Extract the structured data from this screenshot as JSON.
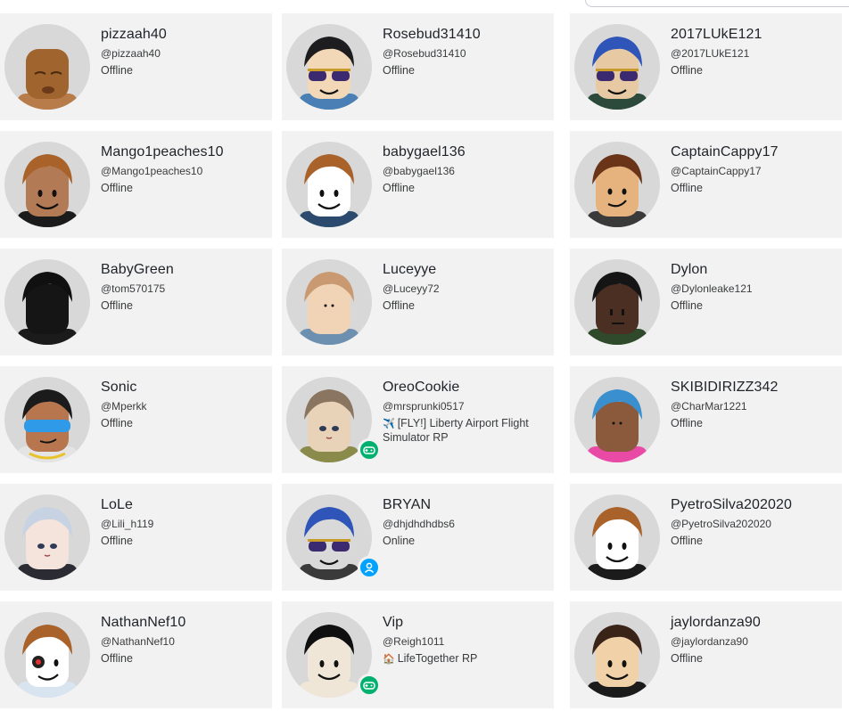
{
  "friends": [
    {
      "name": "pizzaah40",
      "handle": "@pizzaah40",
      "status": "Offline",
      "status_icon": "",
      "presence": "none",
      "avatar": {
        "skin": "#a0652e",
        "hair": "",
        "shirt": "#b87b4a",
        "face": "chubby"
      }
    },
    {
      "name": "Rosebud31410",
      "handle": "@Rosebud31410",
      "status": "Offline",
      "status_icon": "",
      "presence": "none",
      "avatar": {
        "skin": "#f3d8b8",
        "hair": "#1d1d1f",
        "shirt": "#4a7fb5",
        "face": "shades"
      }
    },
    {
      "name": "2017LUkE121",
      "handle": "@2017LUkE121",
      "status": "Offline",
      "status_icon": "",
      "presence": "none",
      "avatar": {
        "skin": "#e7c9a3",
        "hair": "#2f55b8",
        "shirt": "#2c4a3b",
        "face": "shades"
      }
    },
    {
      "name": "Mango1peaches10",
      "handle": "@Mango1peaches10",
      "status": "Offline",
      "status_icon": "",
      "presence": "none",
      "avatar": {
        "skin": "#b27a55",
        "hair": "#a9622a",
        "shirt": "#1b1b1b",
        "face": "smile"
      }
    },
    {
      "name": "babygael136",
      "handle": "@babygael136",
      "status": "Offline",
      "status_icon": "",
      "presence": "none",
      "avatar": {
        "skin": "#ffffff",
        "hair": "#a9622a",
        "shirt": "#2b4a6d",
        "face": "smile"
      }
    },
    {
      "name": "CaptainCappy17",
      "handle": "@CaptainCappy17",
      "status": "Offline",
      "status_icon": "",
      "presence": "none",
      "avatar": {
        "skin": "#e6b37f",
        "hair": "#6a3418",
        "shirt": "#3a3a3a",
        "face": "smirk"
      }
    },
    {
      "name": "BabyGreen",
      "handle": "@tom570175",
      "status": "Offline",
      "status_icon": "",
      "presence": "none",
      "avatar": {
        "skin": "#151515",
        "hair": "#101010",
        "shirt": "#1b1b1b",
        "face": "none"
      }
    },
    {
      "name": "Luceyye",
      "handle": "@Luceyy72",
      "status": "Offline",
      "status_icon": "",
      "presence": "none",
      "avatar": {
        "skin": "#f1d3b6",
        "hair": "#c99a72",
        "shirt": "#6d8fb0",
        "face": "small"
      }
    },
    {
      "name": "Dylon",
      "handle": "@Dylonleake121",
      "status": "Offline",
      "status_icon": "",
      "presence": "none",
      "avatar": {
        "skin": "#4a2f22",
        "hair": "#151515",
        "shirt": "#2e4a2a",
        "face": "plain"
      }
    },
    {
      "name": "Sonic",
      "handle": "@Mperkk",
      "status": "Offline",
      "status_icon": "",
      "presence": "none",
      "avatar": {
        "skin": "#b8764f",
        "hair": "#1b1b1b",
        "shirt": "#e4e4e4",
        "face": "visor"
      }
    },
    {
      "name": "OreoCookie",
      "handle": "@mrsprunki0517",
      "status": "[FLY!] Liberty Airport Flight Simulator RP",
      "status_icon": "✈️",
      "presence": "game",
      "avatar": {
        "skin": "#e8d3b8",
        "hair": "#8a7560",
        "shirt": "#8a8a4a",
        "face": "anime"
      }
    },
    {
      "name": "SKIBIDIRIZZ342",
      "handle": "@CharMar1221",
      "status": "Offline",
      "status_icon": "",
      "presence": "none",
      "avatar": {
        "skin": "#8b5a3c",
        "hair": "#3a8fcf",
        "shirt": "#e84aa5",
        "face": "small"
      }
    },
    {
      "name": "LoLe",
      "handle": "@Lili_h119",
      "status": "Offline",
      "status_icon": "",
      "presence": "none",
      "avatar": {
        "skin": "#f4e4dc",
        "hair": "#c7d3e3",
        "shirt": "#2b2b33",
        "face": "anime"
      }
    },
    {
      "name": "BRYAN",
      "handle": "@dhjdhdhdbs6",
      "status": "Online",
      "status_icon": "",
      "presence": "online",
      "avatar": {
        "skin": "#d9d9d9",
        "hair": "#2f55b8",
        "shirt": "#3a3a3a",
        "face": "shades"
      }
    },
    {
      "name": "PyetroSilva202020",
      "handle": "@PyetroSilva202020",
      "status": "Offline",
      "status_icon": "",
      "presence": "none",
      "avatar": {
        "skin": "#ffffff",
        "hair": "#a9622a",
        "shirt": "#1b1b1b",
        "face": "smile"
      }
    },
    {
      "name": "NathanNef10",
      "handle": "@NathanNef10",
      "status": "Offline",
      "status_icon": "",
      "presence": "none",
      "avatar": {
        "skin": "#ffffff",
        "hair": "#a9622a",
        "shirt": "#d8e4f0",
        "face": "cyborg"
      }
    },
    {
      "name": "Vip",
      "handle": "@Reigh1011",
      "status": "LifeTogether RP",
      "status_icon": "🏠",
      "presence": "game",
      "avatar": {
        "skin": "#efe6d8",
        "hair": "#0f0f0f",
        "shirt": "#efe6d8",
        "face": "smile"
      }
    },
    {
      "name": "jaylordanza90",
      "handle": "@jaylordanza90",
      "status": "Offline",
      "status_icon": "",
      "presence": "none",
      "avatar": {
        "skin": "#f1d2a8",
        "hair": "#3a2418",
        "shirt": "#1b1b1b",
        "face": "smile"
      }
    }
  ],
  "icons": {
    "game_badge": "gamepad-icon",
    "online_badge": "person-icon"
  },
  "colors": {
    "card_bg": "#f2f2f2",
    "game_green": "#00b06f",
    "online_blue": "#00a2ff",
    "avatar_bg": "#d8d8d8"
  }
}
